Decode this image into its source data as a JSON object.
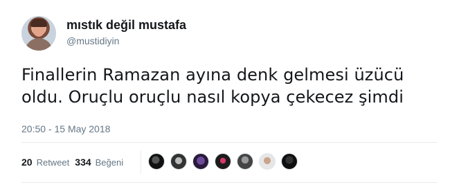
{
  "author": {
    "display_name": "mıstık değil mustafa",
    "handle": "@mustidiyin"
  },
  "tweet": {
    "text_line1": "Finallerin Ramazan ayına denk gelmesi üzücü",
    "text_line2": "oldu. Oruçlu oruçlu nasıl kopya çekecez şimdi",
    "timestamp": "20:50 - 15 May 2018"
  },
  "stats": {
    "retweets": "20",
    "retweets_label": "Retweet",
    "likes": "334",
    "likes_label": "Beğeni"
  },
  "likers": [
    {
      "icon": "liker-avatar-1"
    },
    {
      "icon": "liker-avatar-2"
    },
    {
      "icon": "liker-avatar-3"
    },
    {
      "icon": "liker-avatar-4"
    },
    {
      "icon": "liker-avatar-5"
    },
    {
      "icon": "liker-avatar-6"
    },
    {
      "icon": "liker-avatar-7"
    }
  ]
}
